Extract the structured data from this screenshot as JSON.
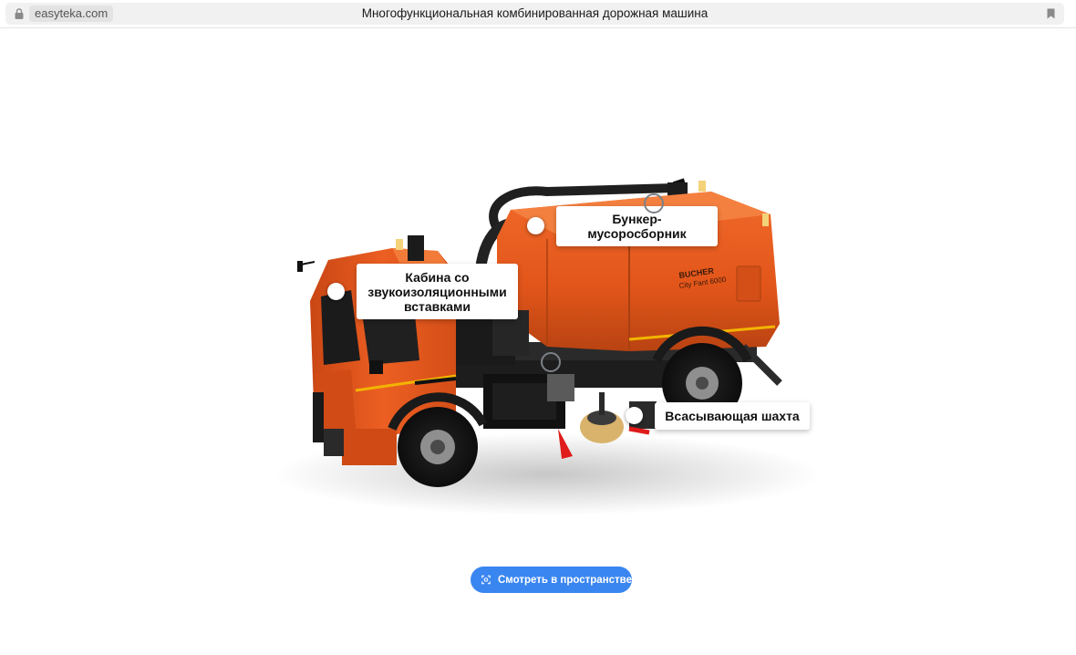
{
  "browser": {
    "domain": "easyteka.com",
    "title": "Многофункциональная комбинированная дорожная машина",
    "icons": {
      "lock": "lock-icon",
      "bookmark": "bookmark-icon"
    }
  },
  "model": {
    "body_text": {
      "brand": "BUCHER",
      "model": "City Fant 6000"
    },
    "colors": {
      "body": "#e8571c",
      "accent_stripe": "#f2b400",
      "brush": "#d9b36c"
    }
  },
  "hotspots": [
    {
      "id": "cabin",
      "label": "Кабина со звукоизоляционными вставками"
    },
    {
      "id": "hopper",
      "label": "Бункер-мусоросборник"
    },
    {
      "id": "suction",
      "label": "Всасывающая шахта"
    }
  ],
  "ar_button": {
    "label": "Смотреть в пространстве",
    "icon": "ar-view-icon",
    "color": "#3a86f0"
  }
}
